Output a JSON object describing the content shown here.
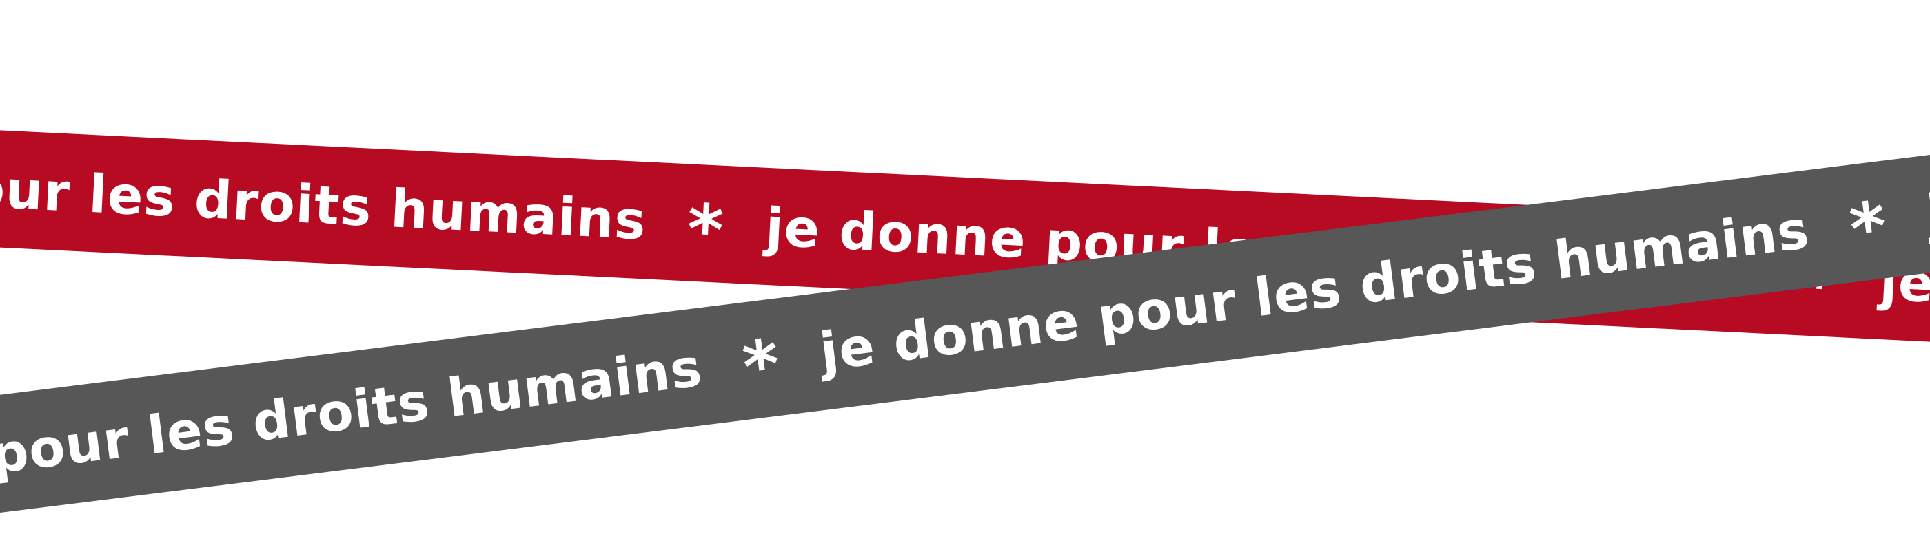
{
  "colors": {
    "background": "#ffffff",
    "red_ribbon": "#b60b22",
    "gray_ribbon": "#575757",
    "text": "#ffffff"
  },
  "ribbons": {
    "slogan": "je donne pour les droits humains",
    "separator": "*"
  }
}
